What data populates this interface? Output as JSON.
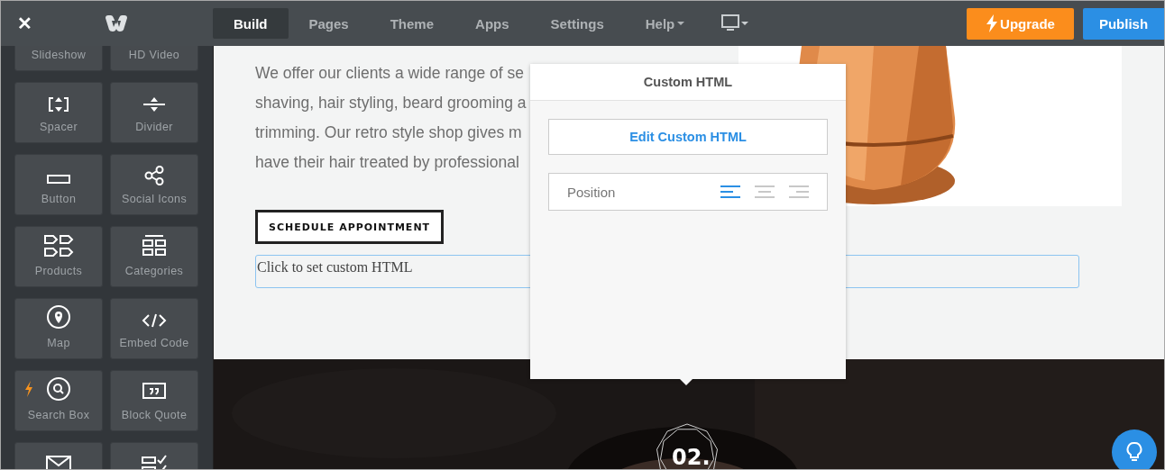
{
  "topbar": {
    "close": "✕",
    "tabs": [
      {
        "label": "Build",
        "selected": true,
        "dropdown": false
      },
      {
        "label": "Pages",
        "selected": false,
        "dropdown": false
      },
      {
        "label": "Theme",
        "selected": false,
        "dropdown": false
      },
      {
        "label": "Apps",
        "selected": false,
        "dropdown": false
      },
      {
        "label": "Settings",
        "selected": false,
        "dropdown": false
      },
      {
        "label": "Help",
        "selected": false,
        "dropdown": true
      }
    ],
    "upgrade": "Upgrade",
    "publish": "Publish"
  },
  "sidebar": {
    "items": [
      {
        "label": "Slideshow"
      },
      {
        "label": "HD Video"
      },
      {
        "label": "Spacer",
        "pro": false
      },
      {
        "label": "Divider",
        "pro": false
      },
      {
        "label": "Button",
        "pro": false
      },
      {
        "label": "Social Icons",
        "pro": false
      },
      {
        "label": "Products",
        "pro": false
      },
      {
        "label": "Categories",
        "pro": false
      },
      {
        "label": "Map",
        "pro": false
      },
      {
        "label": "Embed Code",
        "pro": false
      },
      {
        "label": "Search Box",
        "pro": true
      },
      {
        "label": "Block Quote",
        "pro": false
      },
      {
        "pro": false
      },
      {
        "pro": false
      }
    ]
  },
  "content": {
    "paragraph_lines": [
      "We offer our clients a wide range of se",
      "shaving, hair styling, beard grooming a",
      "trimming. Our retro style shop gives m",
      "have their hair treated by professional"
    ],
    "cta": "SCHEDULE APPOINTMENT",
    "custom_html_placeholder": "Click to set custom HTML",
    "badge": "02."
  },
  "popup": {
    "title": "Custom HTML",
    "edit_button": "Edit Custom HTML",
    "position": {
      "label": "Position",
      "options": [
        {
          "kind": "left",
          "selected": true
        },
        {
          "kind": "center",
          "selected": false
        },
        {
          "kind": "right",
          "selected": false
        }
      ]
    }
  }
}
